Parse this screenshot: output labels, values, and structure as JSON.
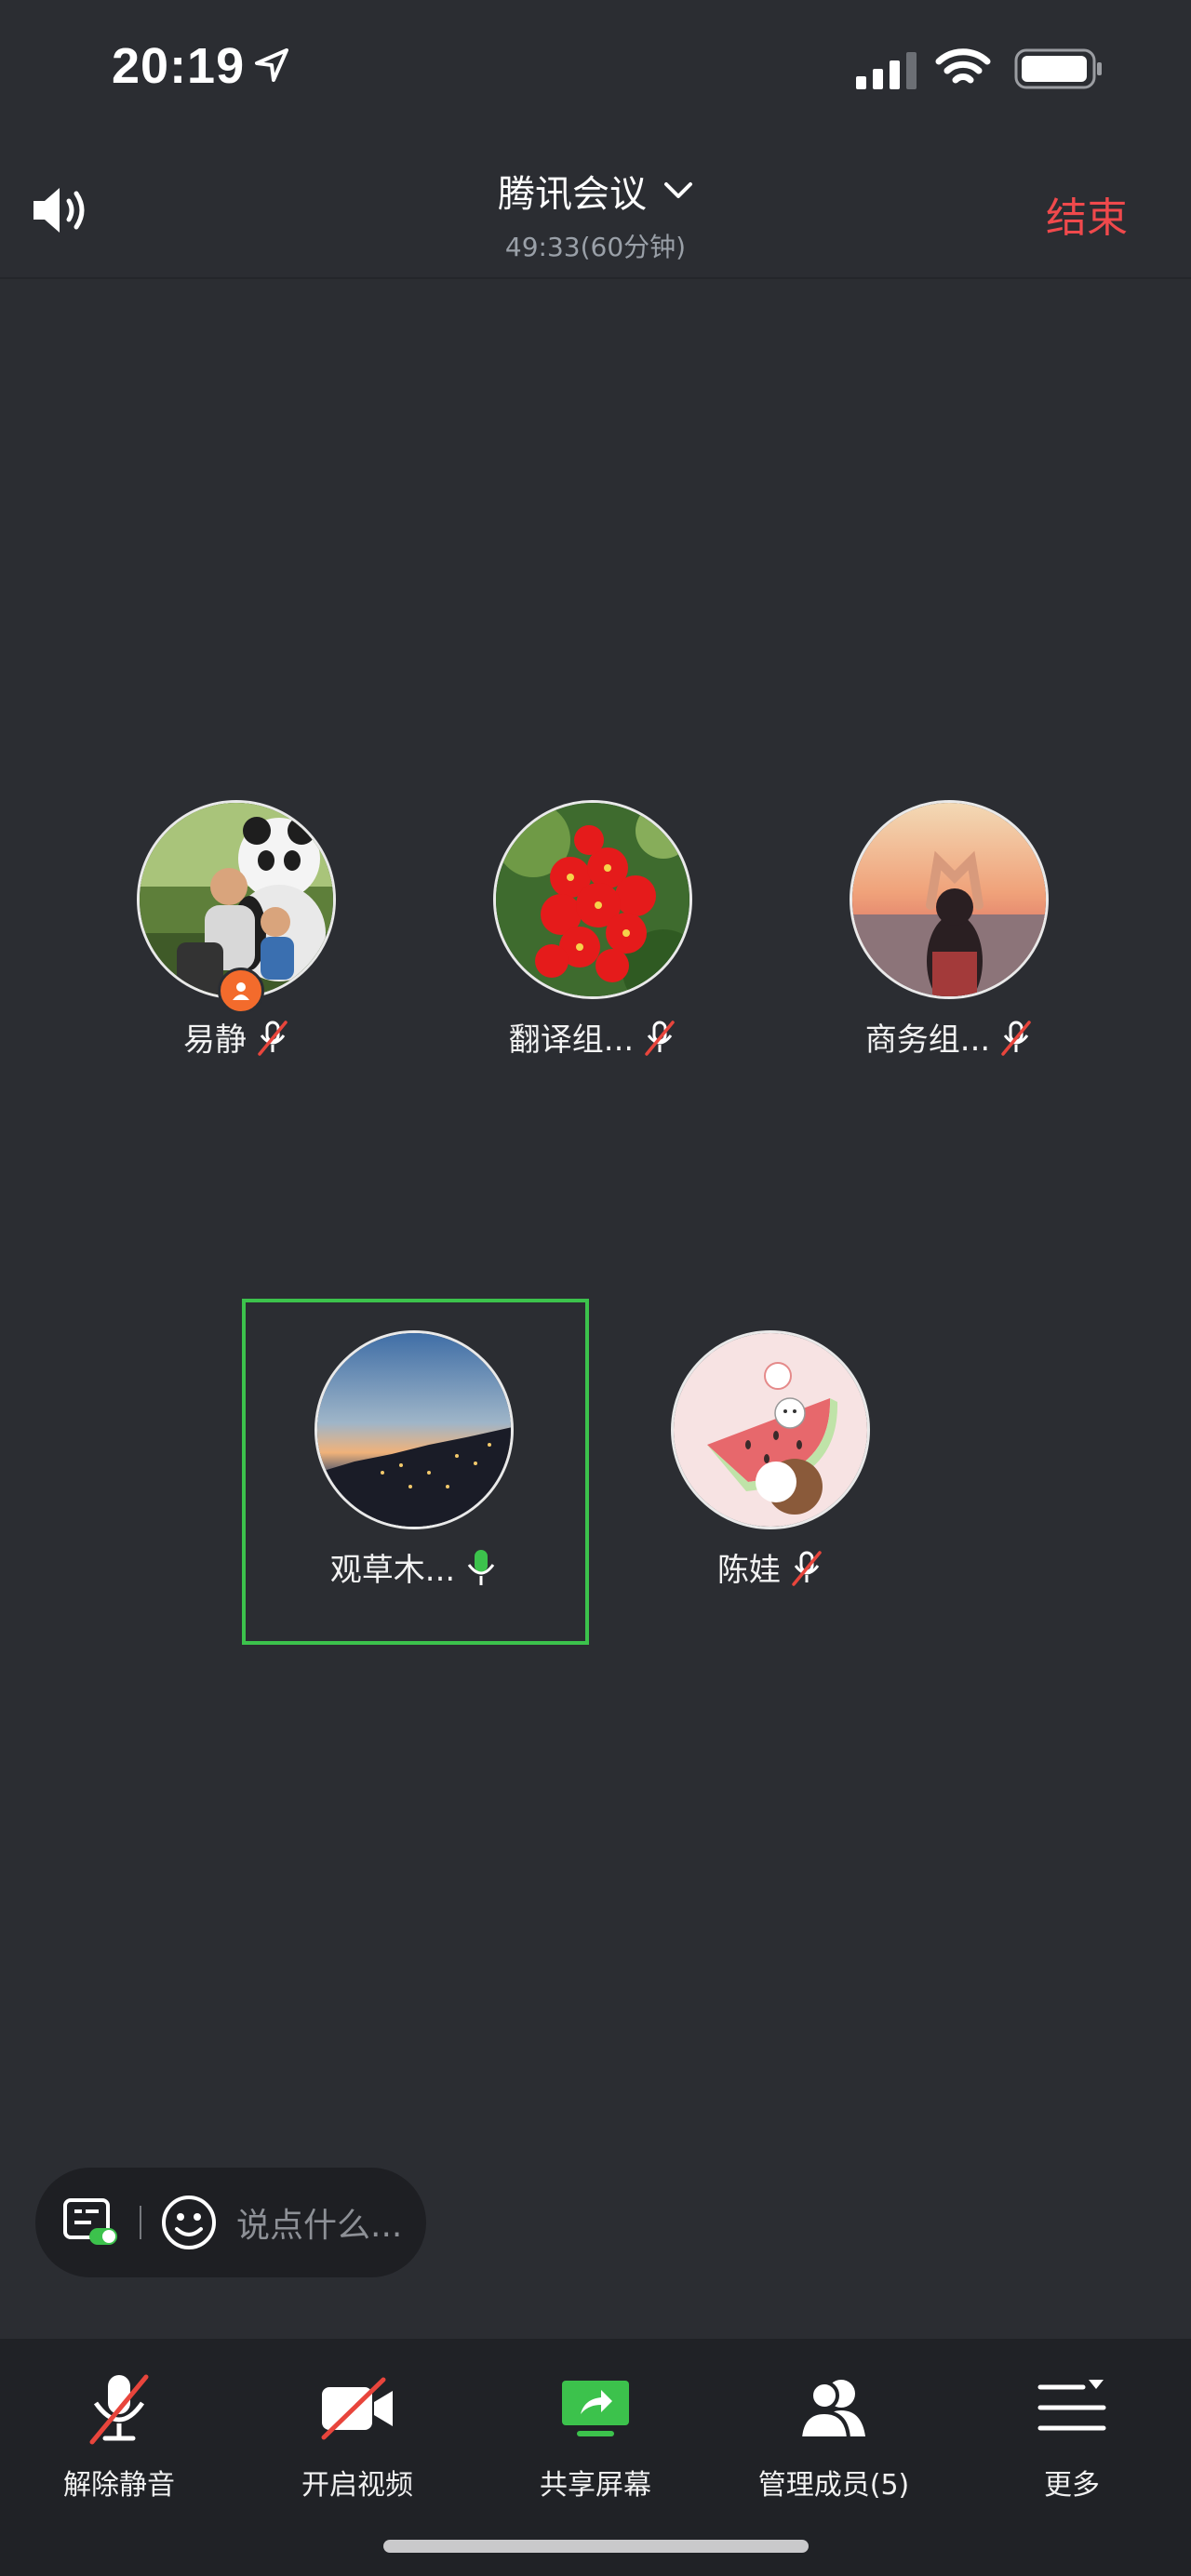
{
  "status_bar": {
    "time": "20:19",
    "icons": [
      "location-arrow-icon",
      "cellular-signal-icon",
      "wifi-icon",
      "battery-icon"
    ]
  },
  "header": {
    "title": "腾讯会议",
    "timer": "49:33(60分钟)",
    "end_label": "结束",
    "end_color": "#f0494c"
  },
  "participants": [
    {
      "name": "易静",
      "mic": "muted",
      "host": true
    },
    {
      "name": "翻译组...",
      "mic": "muted",
      "host": false
    },
    {
      "name": "商务组...",
      "mic": "muted",
      "host": false
    },
    {
      "name": "观草木...",
      "mic": "speaking",
      "host": false,
      "active": true
    },
    {
      "name": "陈娃",
      "mic": "muted",
      "host": false
    }
  ],
  "chat": {
    "placeholder": "说点什么..."
  },
  "toolbar": {
    "unmute": "解除静音",
    "video": "开启视频",
    "share": "共享屏幕",
    "members": "管理成员(5)",
    "more": "更多"
  },
  "colors": {
    "accent_green": "#3cc24c",
    "background": "#2b2d32",
    "mute_red": "#e8453c"
  }
}
